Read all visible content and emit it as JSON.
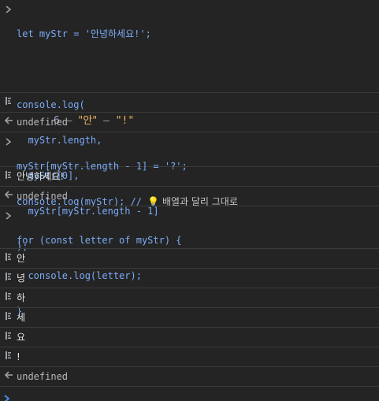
{
  "console": {
    "entry1": {
      "line1": "let myStr = '안녕하세요!';",
      "line2": "",
      "line3": "console.log(",
      "line4": "  myStr.length,",
      "line5": "  myStr[0],",
      "line6": "  myStr[myStr.length - 1]",
      "line7": ");"
    },
    "log1": {
      "num": "6",
      "sep1": " – ",
      "str1": "\"안\"",
      "sep2": " – ",
      "str2": "\"!\""
    },
    "return1": "undefined",
    "entry2": {
      "line1": "myStr[myStr.length - 1] = '?';",
      "line2_code": "console.log(myStr); // ",
      "line2_bulb": "💡",
      "line2_comment": " 배열과 달리 그대로"
    },
    "log2": "안녕하세요!",
    "return2": "undefined",
    "entry3": {
      "line1": "for (const letter of myStr) {",
      "line2": "  console.log(letter);",
      "line3": "}"
    },
    "letters": [
      "안",
      "녕",
      "하",
      "세",
      "요",
      "!"
    ],
    "return3": "undefined"
  },
  "icons": {
    "input": "chevron-right-icon",
    "log": "log-icon",
    "return": "return-arrow-icon"
  },
  "colors": {
    "background": "#242424",
    "code": "#7cacf8",
    "string": "#e6c07b",
    "number": "#b39ddb",
    "prompt": "#4f8ff7"
  }
}
